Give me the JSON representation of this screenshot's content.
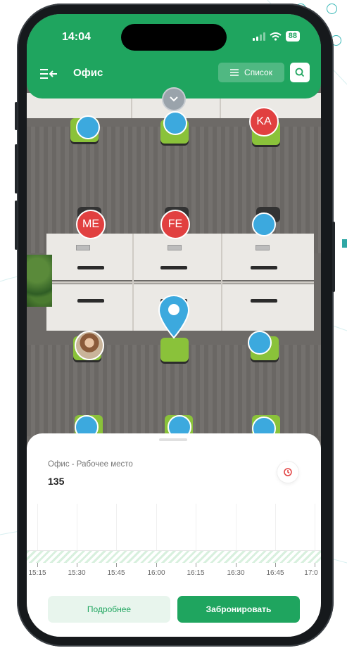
{
  "status_bar": {
    "time": "14:04",
    "battery": "88"
  },
  "header": {
    "title": "Офис",
    "list_label": "Список"
  },
  "icons": {
    "menu": "collapse-menu-icon",
    "search": "search-icon",
    "collapse": "chevron-down-icon",
    "pin": "location-pin-icon",
    "sheet": "history-icon"
  },
  "map": {
    "seats_with_initials": [
      "KA",
      "ME",
      "FE"
    ]
  },
  "sheet": {
    "label": "Офис - Рабочее место",
    "number": "135",
    "timeline": [
      "15:15",
      "15:30",
      "15:45",
      "16:00",
      "16:15",
      "16:30",
      "16:45",
      "17:0"
    ],
    "details_label": "Подробнее",
    "book_label": "Забронировать"
  },
  "colors": {
    "accent": "#1fa55f",
    "seat_free": "#3ca9de",
    "seat_busy": "#e14040"
  }
}
